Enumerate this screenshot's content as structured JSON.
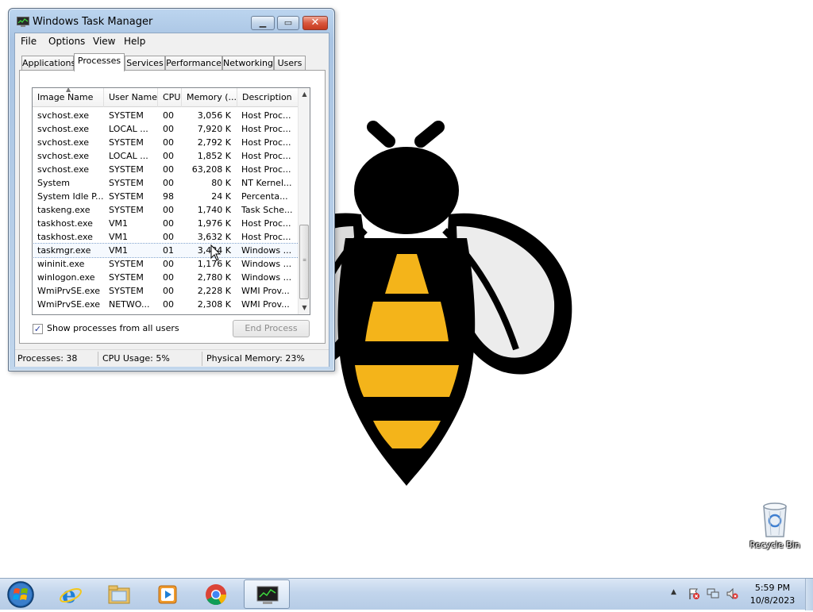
{
  "window": {
    "title": "Windows Task Manager",
    "menu": [
      "File",
      "Options",
      "View",
      "Help"
    ],
    "tabs": [
      "Applications",
      "Processes",
      "Services",
      "Performance",
      "Networking",
      "Users"
    ],
    "active_tab": "Processes",
    "columns": [
      "Image Name",
      "User Name",
      "CPU",
      "Memory (...",
      "Description"
    ],
    "rows": [
      {
        "name": "svchost.exe",
        "user": "SYSTEM",
        "cpu": "00",
        "mem": "3,056 K",
        "desc": "Host Proc..."
      },
      {
        "name": "svchost.exe",
        "user": "LOCAL ...",
        "cpu": "00",
        "mem": "7,920 K",
        "desc": "Host Proc..."
      },
      {
        "name": "svchost.exe",
        "user": "SYSTEM",
        "cpu": "00",
        "mem": "2,792 K",
        "desc": "Host Proc..."
      },
      {
        "name": "svchost.exe",
        "user": "LOCAL ...",
        "cpu": "00",
        "mem": "1,852 K",
        "desc": "Host Proc..."
      },
      {
        "name": "svchost.exe",
        "user": "SYSTEM",
        "cpu": "00",
        "mem": "63,208 K",
        "desc": "Host Proc..."
      },
      {
        "name": "System",
        "user": "SYSTEM",
        "cpu": "00",
        "mem": "80 K",
        "desc": "NT Kernel..."
      },
      {
        "name": "System Idle P...",
        "user": "SYSTEM",
        "cpu": "98",
        "mem": "24 K",
        "desc": "Percenta..."
      },
      {
        "name": "taskeng.exe",
        "user": "SYSTEM",
        "cpu": "00",
        "mem": "1,740 K",
        "desc": "Task Sche..."
      },
      {
        "name": "taskhost.exe",
        "user": "VM1",
        "cpu": "00",
        "mem": "1,976 K",
        "desc": "Host Proc..."
      },
      {
        "name": "taskhost.exe",
        "user": "VM1",
        "cpu": "00",
        "mem": "3,632 K",
        "desc": "Host Proc..."
      },
      {
        "name": "taskmgr.exe",
        "user": "VM1",
        "cpu": "01",
        "mem": "3,484 K",
        "desc": "Windows ..."
      },
      {
        "name": "wininit.exe",
        "user": "SYSTEM",
        "cpu": "00",
        "mem": "1,176 K",
        "desc": "Windows ..."
      },
      {
        "name": "winlogon.exe",
        "user": "SYSTEM",
        "cpu": "00",
        "mem": "2,780 K",
        "desc": "Windows ..."
      },
      {
        "name": "WmiPrvSE.exe",
        "user": "SYSTEM",
        "cpu": "00",
        "mem": "2,228 K",
        "desc": "WMI Prov..."
      },
      {
        "name": "WmiPrvSE.exe",
        "user": "NETWO...",
        "cpu": "00",
        "mem": "2,308 K",
        "desc": "WMI Prov..."
      }
    ],
    "selected_row": 10,
    "show_all_label": "Show processes from all users",
    "show_all_checked": true,
    "end_process_label": "End Process",
    "status": {
      "processes": "Processes: 38",
      "cpu": "CPU Usage: 5%",
      "memory": "Physical Memory: 23%"
    }
  },
  "desktop": {
    "recycle_bin_label": "Recycle Bin"
  },
  "taskbar": {
    "apps": [
      "start-orb",
      "internet-explorer",
      "windows-explorer",
      "media-player",
      "chrome",
      "task-manager"
    ],
    "active_app": "task-manager",
    "clock_time": "5:59 PM",
    "clock_date": "10/8/2023"
  },
  "colors": {
    "bee_yellow": "#f4b41a",
    "bee_black": "#000000",
    "wing_gray": "#dcdcdc",
    "taskbar": "#c2d5ec",
    "window_frame": "#a9c4e3"
  }
}
